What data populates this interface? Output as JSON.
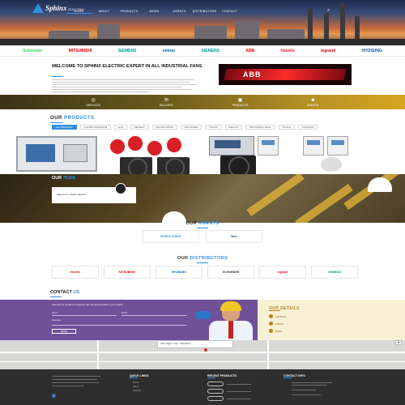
{
  "header": {
    "logo_text": "Sphinx",
    "logo_sub": "ELECTRIC",
    "nav": [
      "HOME",
      "ABOUT",
      "PRODUCTS",
      "NEWS",
      "AGENTS",
      "DISTRIBUTORS",
      "CONTACT"
    ],
    "search_icon": "search-icon"
  },
  "brands": [
    {
      "name": "Schneider",
      "color": "#3dcd58"
    },
    {
      "name": "MITSUBISHI",
      "color": "#e60012"
    },
    {
      "name": "SIEMENS",
      "color": "#009999"
    },
    {
      "name": "omron",
      "color": "#005bab"
    },
    {
      "name": "SIEMENS",
      "color": "#009999"
    },
    {
      "name": "ABB",
      "color": "#ff000f"
    },
    {
      "name": "Havells",
      "color": "#e31e24"
    },
    {
      "name": "legrand",
      "color": "#d4001a"
    },
    {
      "name": "HYOSUNG",
      "color": "#0054a6"
    }
  ],
  "welcome": {
    "title": "WELCOME TO SPHINX ELECTRIC EXPERT IN ALL INDUSTRIAL FANS",
    "abb_word": "ABB"
  },
  "features": [
    {
      "icon": "◎",
      "label": "SERVICES"
    },
    {
      "icon": "✉",
      "label": "DELIVERY"
    },
    {
      "icon": "▣",
      "label": "PRODUCTS"
    },
    {
      "icon": "☻",
      "label": "AGENTS"
    }
  ],
  "products": {
    "title_a": "OUR",
    "title_b": "PRODUCTS",
    "filters": [
      "ALL PRODUCT",
      "CONTACTORS/MCB",
      "ELR",
      "METERS",
      "MOTOR DRIVE",
      "FAN FILTER",
      "TOOLS",
      "RELAYS",
      "INDUSTRIAL FANS",
      "PLUGS",
      "SOCKETS"
    ]
  },
  "team": {
    "title_a": "OUR",
    "title_b": "TEAM",
    "card_text": "Welcome to Sphinx Electric"
  },
  "agents": {
    "title_a": "OUR",
    "title_b": "AGENTS",
    "logos": [
      "SPHINX AGENT",
      "Ikon"
    ]
  },
  "distributors": {
    "title_a": "OUR",
    "title_b": "DISTRIBUTORS",
    "logos": [
      "Havells",
      "MITSUBISHI",
      "HYOSUNG",
      "SCHNEIDER",
      "legrand",
      "SIEMENS"
    ]
  },
  "contact": {
    "title_a": "CONTACT",
    "title_b": "US",
    "intro": "Feel free to contact us anytime and we will get back to you shortly",
    "name_label": "Name",
    "email_label": "Email",
    "message_label": "Message",
    "send_label": "SEND"
  },
  "details": {
    "title": "OUR DETAILS",
    "rows": [
      "ADDRESS",
      "PHONE",
      "EMAIL"
    ]
  },
  "map": {
    "tooltip": "View larger map · Directions"
  },
  "footer": {
    "quick_links_title": "QUICK LINKS",
    "quick_links": [
      "Home",
      "About",
      "Contact"
    ],
    "recent_title": "RECENT PRODUCTS",
    "news_title": "CONTACT INFO",
    "fb": "f"
  }
}
